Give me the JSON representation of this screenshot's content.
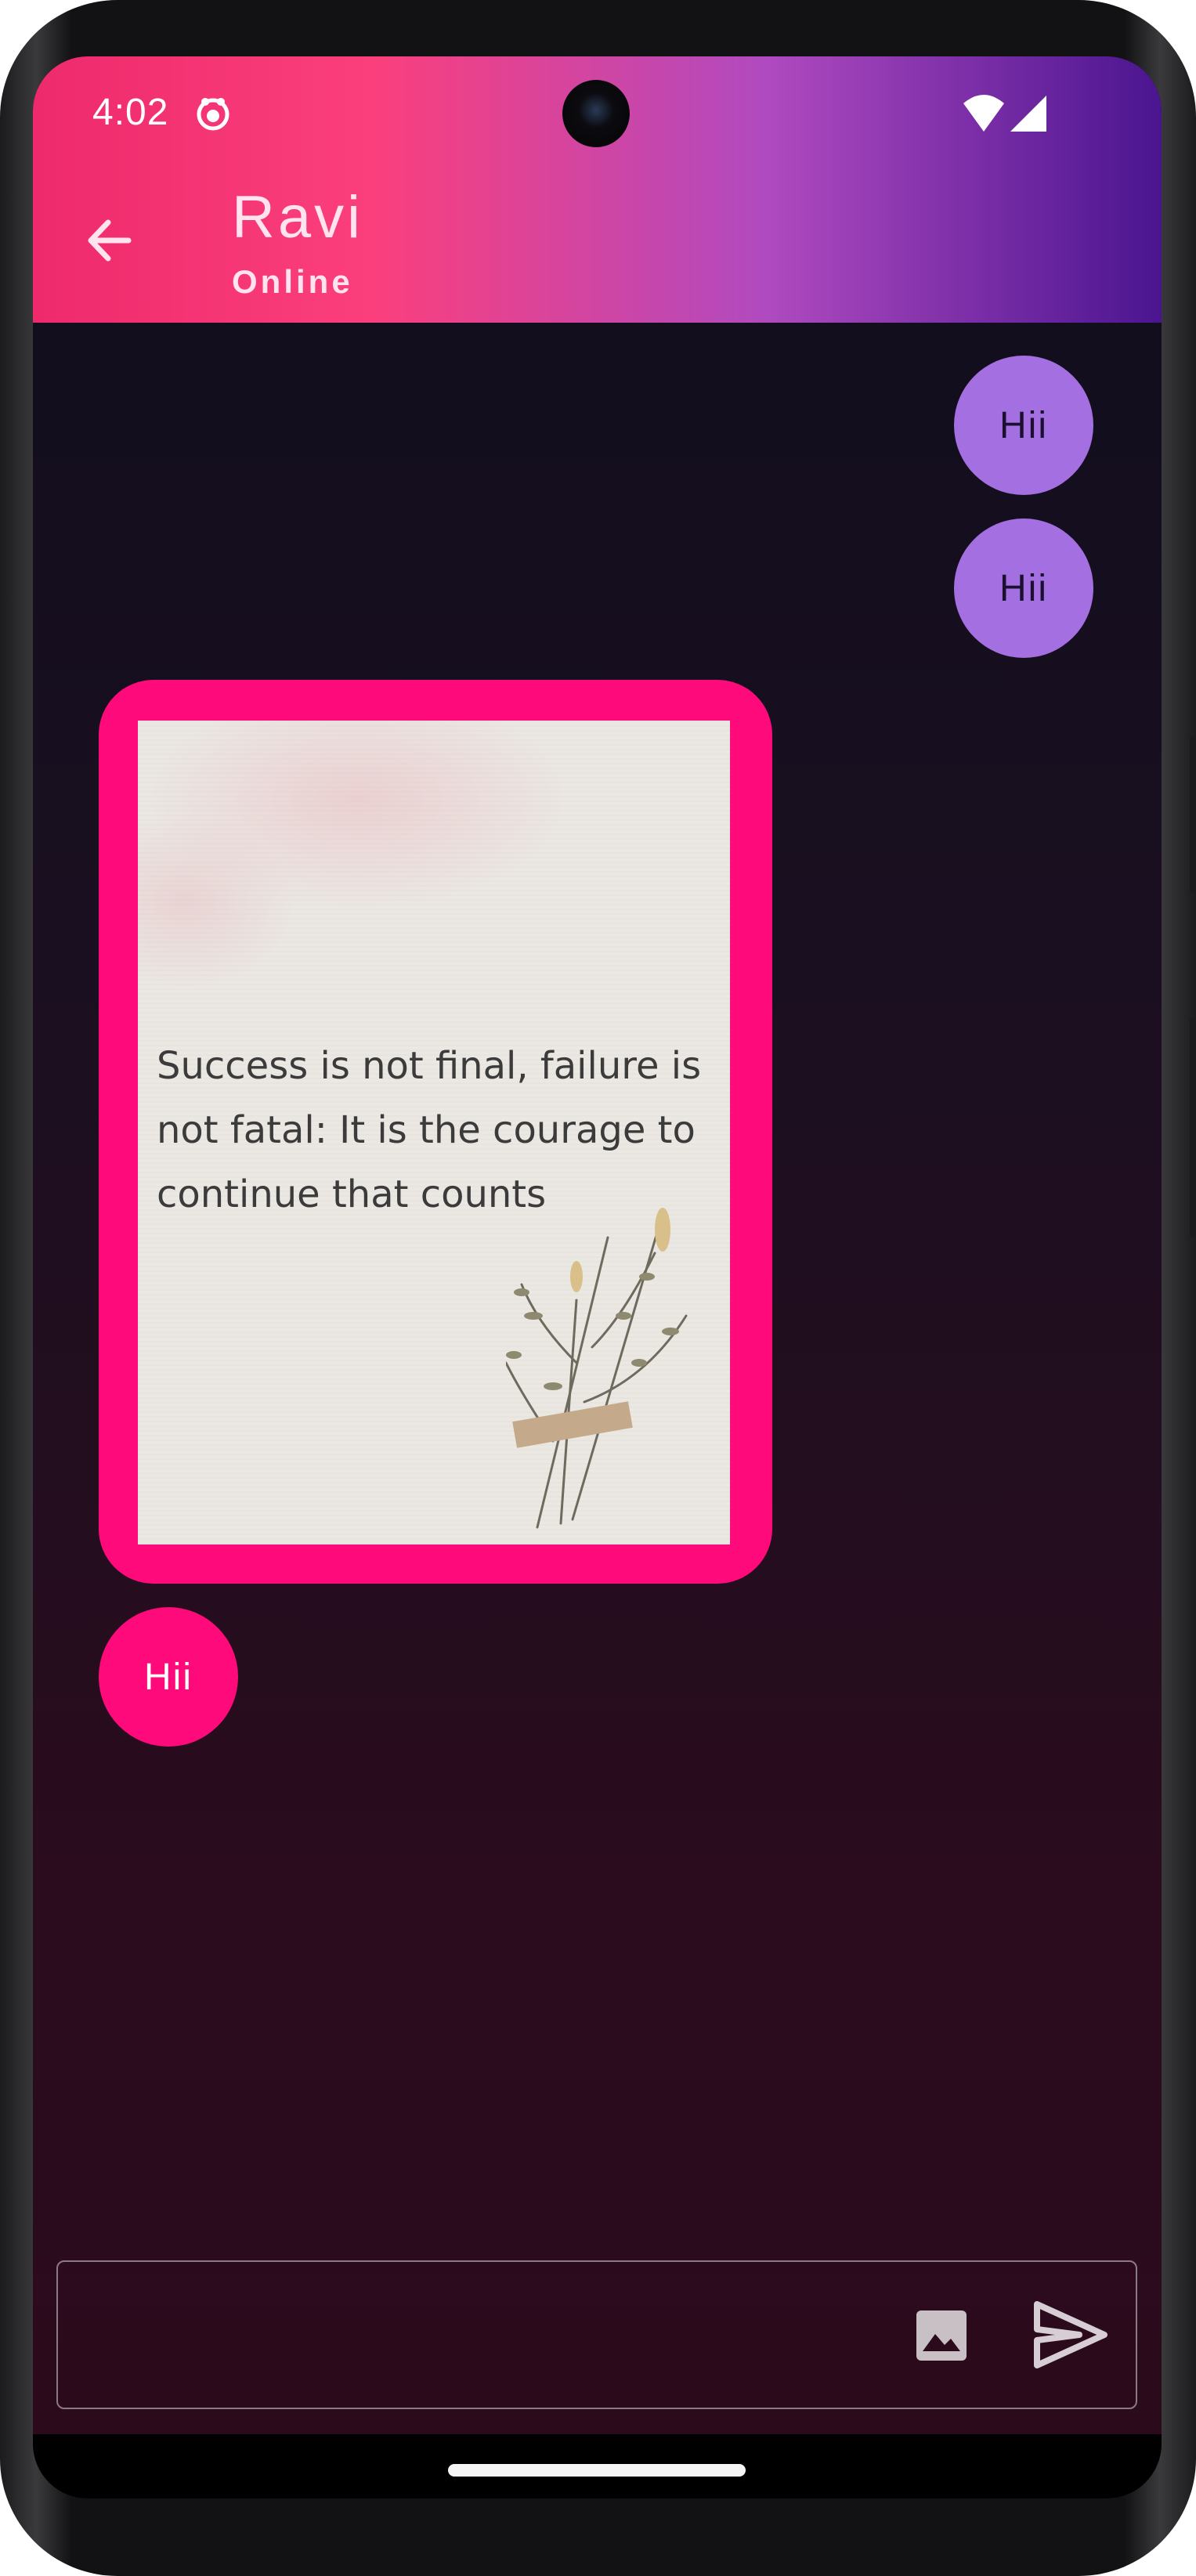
{
  "status_bar": {
    "time": "4:02",
    "icons": [
      "notification-icon",
      "wifi-icon",
      "signal-icon"
    ]
  },
  "header": {
    "contact_name": "Ravi",
    "contact_status": "Online",
    "back_icon": "back-arrow-icon"
  },
  "messages": [
    {
      "direction": "sent",
      "type": "text",
      "text": "Hii"
    },
    {
      "direction": "sent",
      "type": "text",
      "text": "Hii"
    },
    {
      "direction": "received",
      "type": "image",
      "image_text": "Success is not final, failure is not fatal: It is the courage to continue that counts"
    },
    {
      "direction": "received",
      "type": "text",
      "text": "Hii"
    }
  ],
  "composer": {
    "value": "",
    "attach_icon": "image-icon",
    "send_icon": "send-icon"
  },
  "colors": {
    "sent_bubble": "#a46fe0",
    "received_bubble": "#ff0a7a",
    "header_gradient_start": "#ee2a6c",
    "header_gradient_end": "#4a1590"
  }
}
